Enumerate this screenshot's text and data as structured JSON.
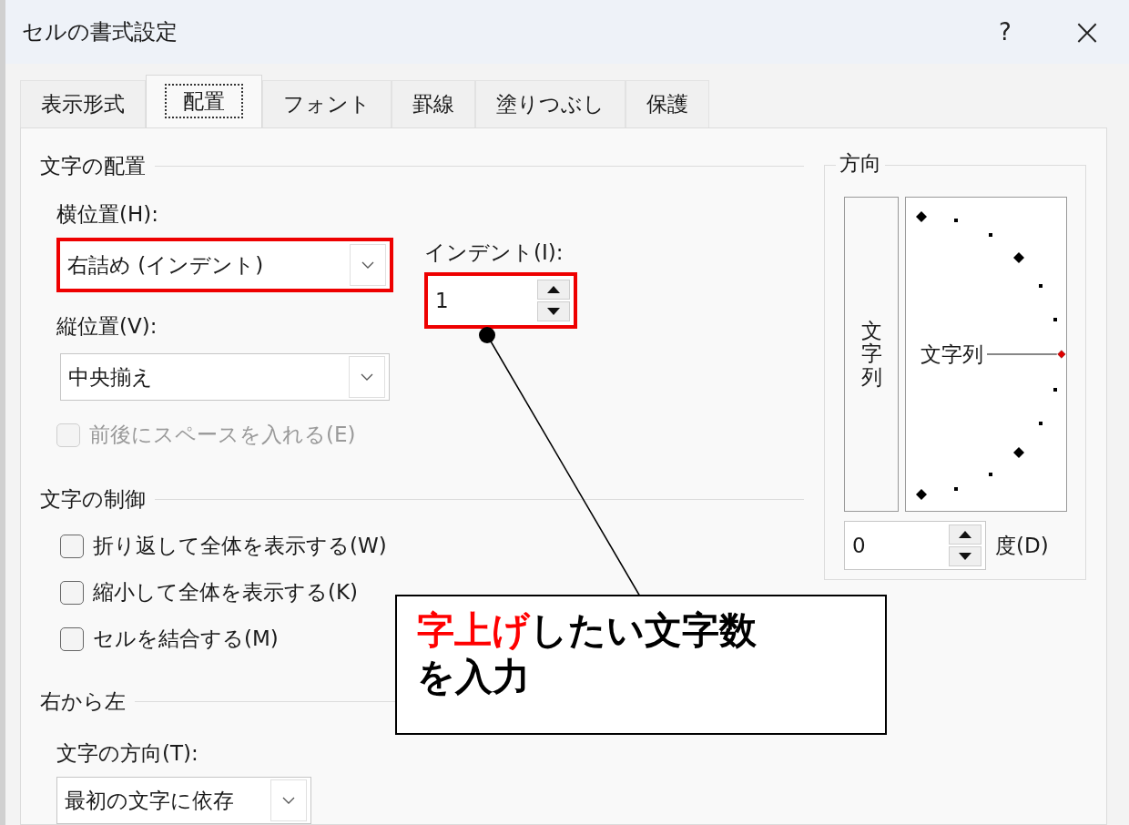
{
  "window": {
    "title": "セルの書式設定",
    "help": "?",
    "close": "×"
  },
  "tabs": [
    {
      "label": "表示形式",
      "selected": false
    },
    {
      "label": "配置",
      "selected": true
    },
    {
      "label": "フォント",
      "selected": false
    },
    {
      "label": "罫線",
      "selected": false
    },
    {
      "label": "塗りつぶし",
      "selected": false
    },
    {
      "label": "保護",
      "selected": false
    }
  ],
  "alignment": {
    "title": "文字の配置",
    "horizontal": {
      "label": "横位置(H):",
      "value": "右詰め (インデント)",
      "highlighted": true
    },
    "vertical": {
      "label": "縦位置(V):",
      "value": "中央揃え",
      "highlighted": false
    },
    "indent": {
      "label": "インデント(I):",
      "value": "1",
      "highlighted": true
    },
    "distributed": {
      "label": "前後にスペースを入れる(E)",
      "checked": false,
      "disabled": true
    }
  },
  "text_control": {
    "title": "文字の制御",
    "options": [
      {
        "label": "折り返して全体を表示する(W)",
        "checked": false
      },
      {
        "label": "縮小して全体を表示する(K)",
        "checked": false
      },
      {
        "label": "セルを結合する(M)",
        "checked": false
      }
    ]
  },
  "right_to_left": {
    "title": "右から左",
    "direction": {
      "label": "文字の方向(T):",
      "value": "最初の文字に依存"
    }
  },
  "orientation": {
    "title": "方向",
    "vertical_text": "文字列",
    "dial_text": "文字列",
    "degrees": {
      "value": "0",
      "unit": "度(D)"
    }
  },
  "callout": {
    "parts": [
      {
        "text": "字上げ",
        "color": "#ff0000"
      },
      {
        "text": "したい文字数を入力",
        "color": "#000000"
      }
    ]
  }
}
